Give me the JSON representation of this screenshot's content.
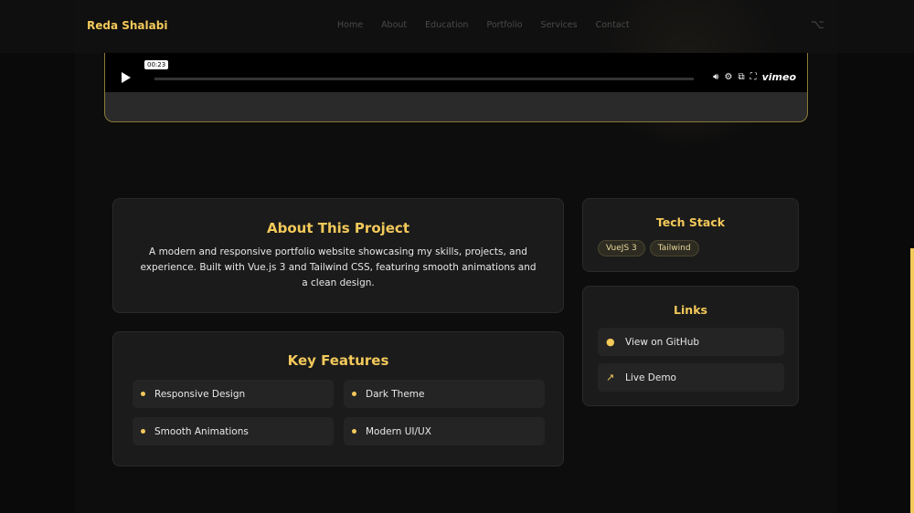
{
  "nav": {
    "brand": "Reda Shalabi",
    "links": [
      "Home",
      "About",
      "Education",
      "Portfolio",
      "Services",
      "Contact"
    ]
  },
  "video": {
    "time": "00:23",
    "logo": "vimeo"
  },
  "about": {
    "title": "About This Project",
    "text": "A modern and responsive portfolio website showcasing my skills, projects, and experience. Built with Vue.js 3 and Tailwind CSS, featuring smooth animations and a clean design."
  },
  "features": {
    "title": "Key Features",
    "items": [
      "Responsive Design",
      "Dark Theme",
      "Smooth Animations",
      "Modern UI/UX"
    ]
  },
  "tech": {
    "title": "Tech Stack",
    "items": [
      "VueJS 3",
      "Tailwind"
    ]
  },
  "links": {
    "title": "Links",
    "github": "View on GitHub",
    "demo": "Live Demo"
  }
}
